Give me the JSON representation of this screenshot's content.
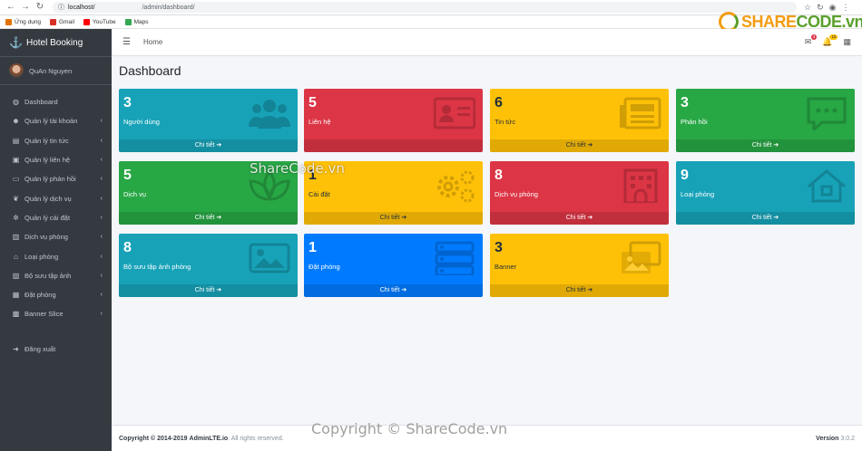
{
  "browser": {
    "url_host": "localhost/",
    "url_path": "/admin/dashboard/"
  },
  "bookmarks": [
    {
      "label": "Ứng dụng",
      "color": "#e37400"
    },
    {
      "label": "Gmail",
      "color": "#d93025"
    },
    {
      "label": "YouTube",
      "color": "#ff0000"
    },
    {
      "label": "Maps",
      "color": "#34a853"
    }
  ],
  "brand": {
    "title": "Hotel Booking"
  },
  "user": {
    "name": "QuAn Nguyen"
  },
  "menu": [
    {
      "label": "Dashboard",
      "icon": "dashboard-icon",
      "glyph": "◍",
      "arrow": ""
    },
    {
      "label": "Quản lý tài khoản",
      "icon": "users-icon",
      "glyph": "☻",
      "arrow": "‹"
    },
    {
      "label": "Quản lý tin tức",
      "icon": "newspaper-icon",
      "glyph": "▤",
      "arrow": "‹"
    },
    {
      "label": "Quản lý liên hệ",
      "icon": "contact-icon",
      "glyph": "▣",
      "arrow": "‹"
    },
    {
      "label": "Quản lý phản hồi",
      "icon": "comment-icon",
      "glyph": "▭",
      "arrow": "‹"
    },
    {
      "label": "Quản lý dịch vụ",
      "icon": "spa-icon",
      "glyph": "❦",
      "arrow": "‹"
    },
    {
      "label": "Quản lý cài đặt",
      "icon": "cogs-icon",
      "glyph": "✲",
      "arrow": "‹"
    },
    {
      "label": "Dịch vụ phòng",
      "icon": "building-icon",
      "glyph": "▥",
      "arrow": "‹"
    },
    {
      "label": "Loại phòng",
      "icon": "home-icon",
      "glyph": "⌂",
      "arrow": "‹"
    },
    {
      "label": "Bộ sưu tập ảnh",
      "icon": "image-icon",
      "glyph": "▨",
      "arrow": "‹"
    },
    {
      "label": "Đặt phòng",
      "icon": "server-icon",
      "glyph": "▦",
      "arrow": "‹"
    },
    {
      "label": "Banner Slice",
      "icon": "images-icon",
      "glyph": "▩",
      "arrow": "‹"
    },
    {
      "label": "Đăng xuất",
      "icon": "sign-out-icon",
      "glyph": "➜",
      "arrow": ""
    }
  ],
  "topbar": {
    "home": "Home",
    "msg_badge": "3",
    "notif_badge": "15"
  },
  "page_title": "Dashboard",
  "tiles": [
    {
      "num": "3",
      "label": "Người dùng",
      "footer": "Chi tiết ➔",
      "color": "info",
      "icon": "users-icon"
    },
    {
      "num": "5",
      "label": "Liên hệ",
      "footer": "",
      "color": "danger",
      "icon": "address-card-icon"
    },
    {
      "num": "6",
      "label": "Tin tức",
      "footer": "Chi tiết ➔",
      "color": "yellow",
      "icon": "newspaper-icon"
    },
    {
      "num": "3",
      "label": "Phản hồi",
      "footer": "Chi tiết ➔",
      "color": "success",
      "icon": "comment-icon"
    },
    {
      "num": "5",
      "label": "Dịch vụ",
      "footer": "Chi tiết ➔",
      "color": "success",
      "icon": "spa-icon"
    },
    {
      "num": "1",
      "label": "Cài đặt",
      "footer": "Chi tiết ➔",
      "color": "yellow",
      "icon": "cogs-icon"
    },
    {
      "num": "8",
      "label": "Dịch vụ phòng",
      "footer": "Chi tiết ➔",
      "color": "danger",
      "icon": "building-icon"
    },
    {
      "num": "9",
      "label": "Loại phòng",
      "footer": "Chi tiết ➔",
      "color": "info",
      "icon": "home-icon"
    },
    {
      "num": "8",
      "label": "Bộ sưu tập ảnh phòng",
      "footer": "Chi tiết ➔",
      "color": "info",
      "icon": "image-icon"
    },
    {
      "num": "1",
      "label": "Đặt phòng",
      "footer": "Chi tiết ➔",
      "color": "primary",
      "icon": "server-icon"
    },
    {
      "num": "3",
      "label": "Banner",
      "footer": "Chi tiết ➔",
      "color": "yellow",
      "icon": "images-icon"
    }
  ],
  "footer": {
    "copyright": "Copyright © 2014-2019",
    "brand": "AdminLTE.io",
    "rights": ". All rights reserved.",
    "version_label": "Version",
    "version": "3.0.2"
  },
  "watermark": {
    "top": "ShareCode.vn",
    "bottom": "Copyright © ShareCode.vn"
  },
  "logo": {
    "main": "SHARE",
    "suffix": "CODE.vn"
  }
}
